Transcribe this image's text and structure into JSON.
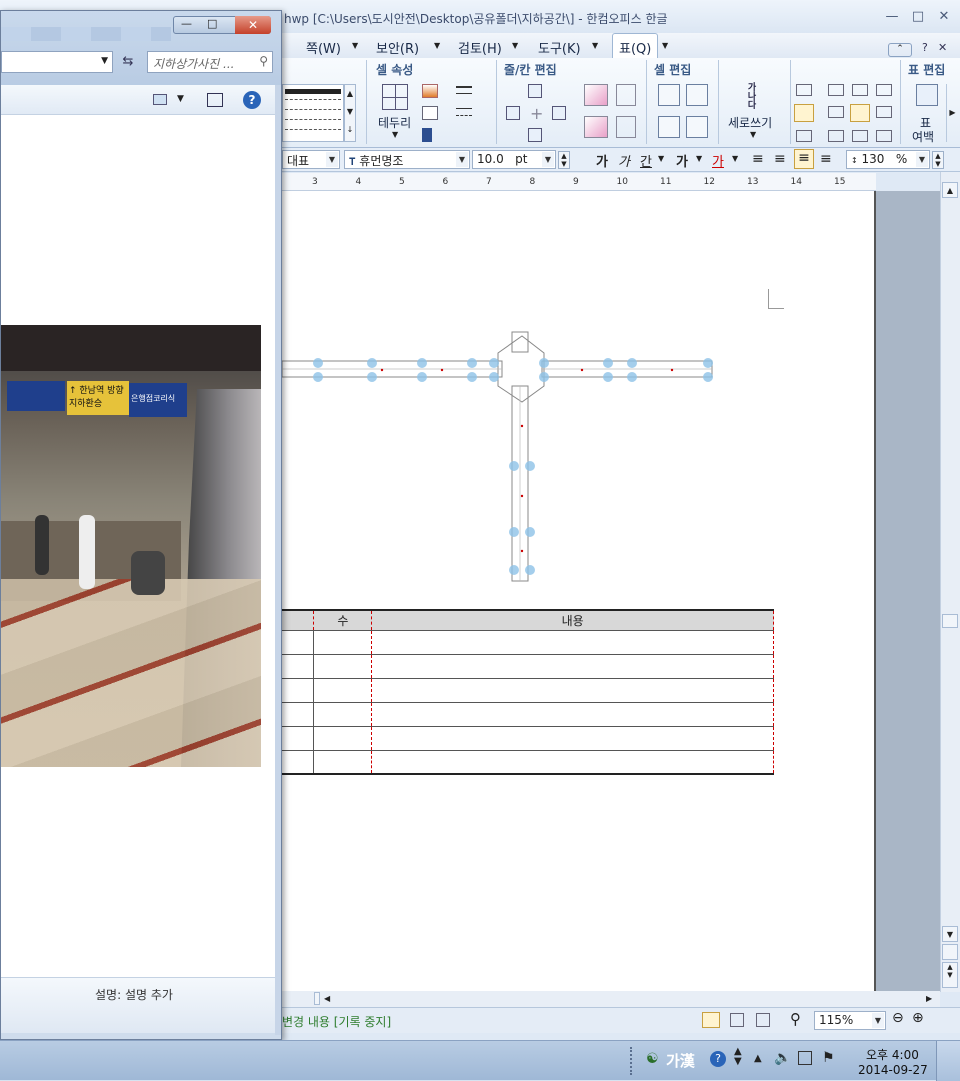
{
  "hwp": {
    "title": "hwp [C:\\Users\\도시안전\\Desktop\\공유폴더\\지하공간\\] - 한컴오피스 한글",
    "menus": [
      {
        "label": "쪽(W)"
      },
      {
        "label": "보안(R)"
      },
      {
        "label": "검토(H)"
      },
      {
        "label": "도구(K)"
      },
      {
        "label": "표(Q)"
      }
    ],
    "ribbon": {
      "group_cell_props": "셀 속성",
      "group_row_col": "줄/칸 편집",
      "group_cell_edit": "셀 편집",
      "group_table_edit": "표 편집",
      "border_label": "테두리",
      "vertical_text_label": "세로쓰기",
      "vertical_text_glyph": "가나다",
      "table_margin_label1": "표",
      "table_margin_label2": "여백"
    },
    "format": {
      "style": "대표",
      "font": "휴먼명조",
      "size": "10.0",
      "unit": "pt",
      "bold": "가",
      "italic": "가",
      "underline": "간",
      "strike": "가",
      "color": "가",
      "line_spacing": "130",
      "percent": "%"
    },
    "ruler_ticks": [
      "3",
      "4",
      "5",
      "6",
      "7",
      "8",
      "9",
      "10",
      "11",
      "12",
      "13",
      "14",
      "15"
    ],
    "table": {
      "headers": [
        "",
        "수",
        "내용"
      ],
      "rows": 7
    },
    "status": {
      "track_changes": "변경 내용 [기록 중지]",
      "zoom": "115%"
    }
  },
  "explorer": {
    "search_placeholder": "지하상가사진 ...",
    "description": "설명: 설명 추가",
    "photo_sign1": "한남역 방향",
    "photo_sign2": "지하환승",
    "photo_sign3": "은행점코리식"
  },
  "taskbar": {
    "ime": "가漢",
    "time": "오후 4:00",
    "date": "2014-09-27"
  },
  "colors": {
    "accent": "#3a5a86",
    "table_dash": "#cc0000"
  }
}
